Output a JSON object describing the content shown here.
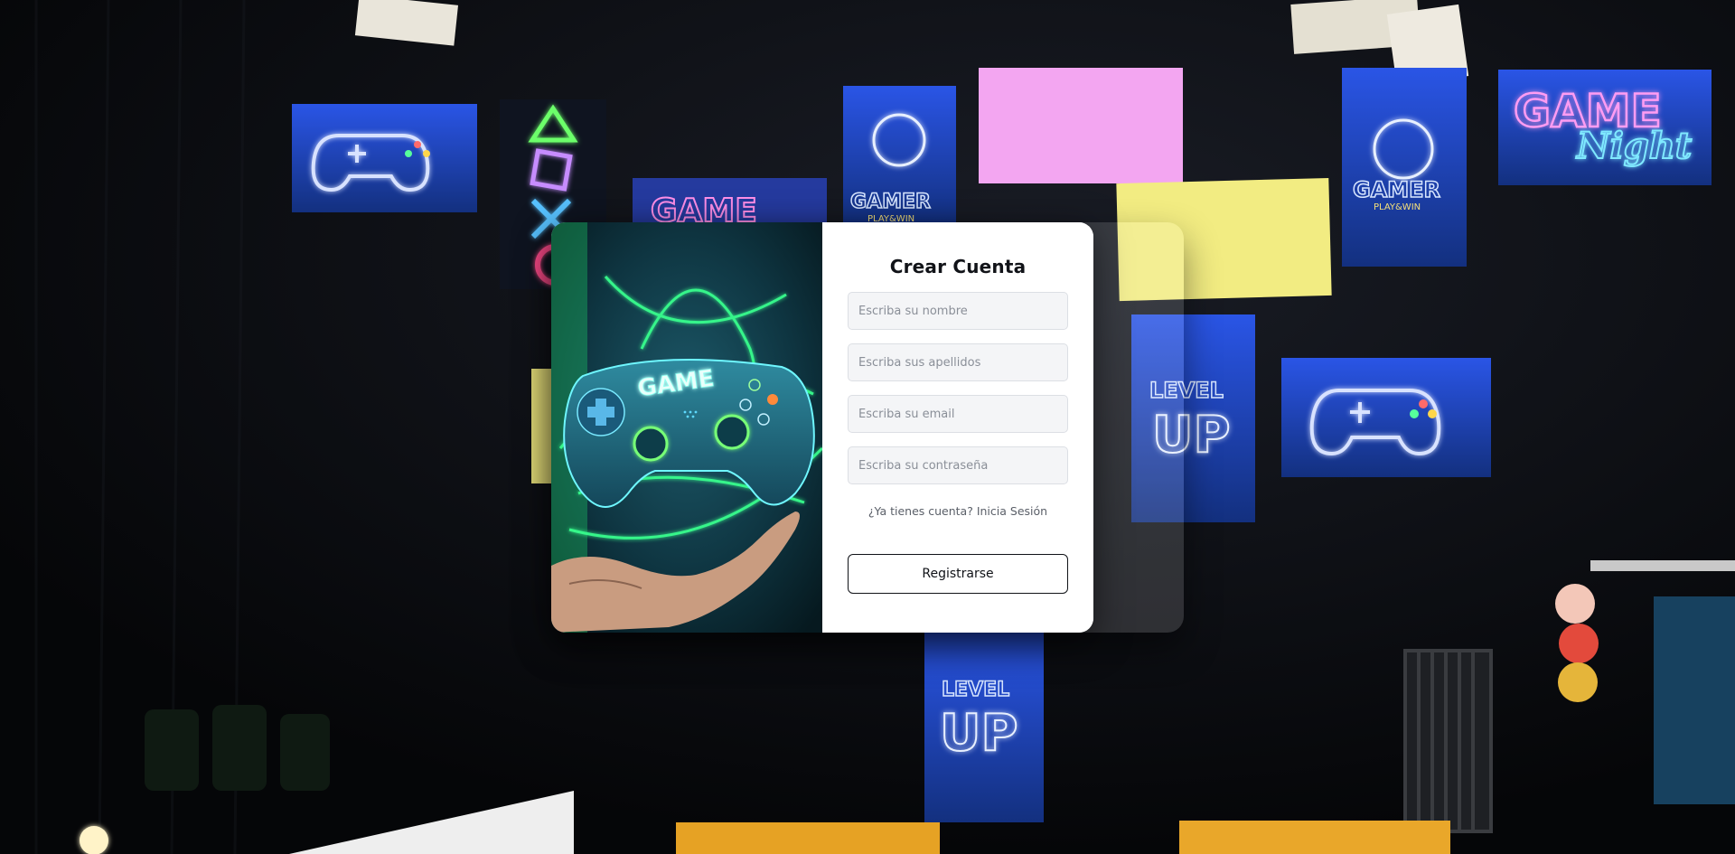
{
  "register": {
    "title": "Crear Cuenta",
    "fields": {
      "first_name_placeholder": "Escriba su nombre",
      "last_name_placeholder": "Escriba sus apellidos",
      "email_placeholder": "Escriba su email",
      "password_placeholder": "Escriba su contraseña"
    },
    "login_link": "¿Ya tienes cuenta? Inicia Sesión",
    "submit_label": "Registrarse"
  },
  "background": {
    "signs": {
      "game": "GAME",
      "game_night_top": "GAME",
      "game_night_bottom": "Night",
      "gamer": "GAMER",
      "gamer_sub": "PLAY&WIN",
      "level": "LEVEL",
      "up": "UP"
    }
  },
  "illustration": {
    "controller_label": "GAME"
  },
  "colors": {
    "neon_blue": "#2f6dff",
    "neon_pink": "#ff6ad5",
    "neon_green": "#29ff8a",
    "neon_yellow": "#f6f08a",
    "card_bg": "#ffffff",
    "text_dark": "#111318"
  }
}
